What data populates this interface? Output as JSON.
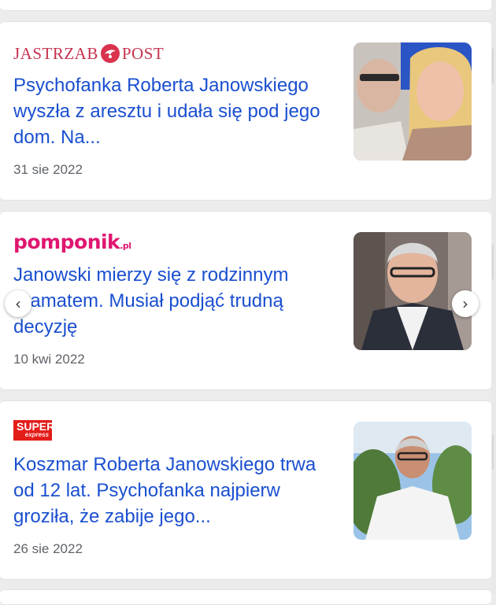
{
  "articles": [
    {
      "source": "JASTRZAB POST",
      "headline": "Psychofanka Roberta Janowskiego wyszła z aresztu i udała się pod jego dom. Na...",
      "date": "31 sie 2022"
    },
    {
      "source": "pomponik.pl",
      "headline": "Janowski mierzy się z rodzinnym dramatem. Musiał podjąć trudną decyzję",
      "date": "10 kwi 2022"
    },
    {
      "source": "SUPER express",
      "headline": "Koszmar Roberta Janowskiego trwa od 12 lat. Psychofanka najpierw groziła, że zabije jego...",
      "date": "26 sie 2022"
    }
  ],
  "logos": {
    "jastrzab_left": "JASTRZAB",
    "jastrzab_right": "POST",
    "pomponik_main": "pomponik",
    "pomponik_suffix": ".pl",
    "super_main": "SUPER",
    "super_sub": "express"
  },
  "nav": {
    "prev_icon": "chevron-left-icon",
    "next_icon": "chevron-right-icon",
    "prev_glyph": "‹",
    "next_glyph": "›"
  },
  "colors": {
    "headline": "#1a4fd0",
    "date": "#5f6368",
    "pomponik": "#e0166f",
    "jastrzab": "#c8324f",
    "super": "#e31d1a"
  }
}
